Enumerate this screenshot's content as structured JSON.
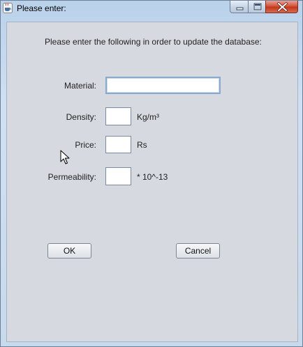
{
  "window": {
    "title": "Please enter:",
    "icon": "java-cup-icon",
    "controls": [
      "minimize-icon",
      "maximize-icon",
      "close-icon"
    ]
  },
  "form": {
    "instruction": "Please enter the following in order to update the database:",
    "fields": [
      {
        "label": "Material:",
        "value": "",
        "unit": ""
      },
      {
        "label": "Density:",
        "value": "",
        "unit": "Kg/m³"
      },
      {
        "label": "Price:",
        "value": "",
        "unit": "Rs"
      },
      {
        "label": "Permeability:",
        "value": "",
        "unit": "* 10^-13"
      }
    ]
  },
  "buttons": {
    "ok": "OK",
    "cancel": "Cancel"
  },
  "colors": {
    "title_bar": "#c7d9ec",
    "panel": "#d6d9df",
    "close_button": "#c2381d"
  }
}
